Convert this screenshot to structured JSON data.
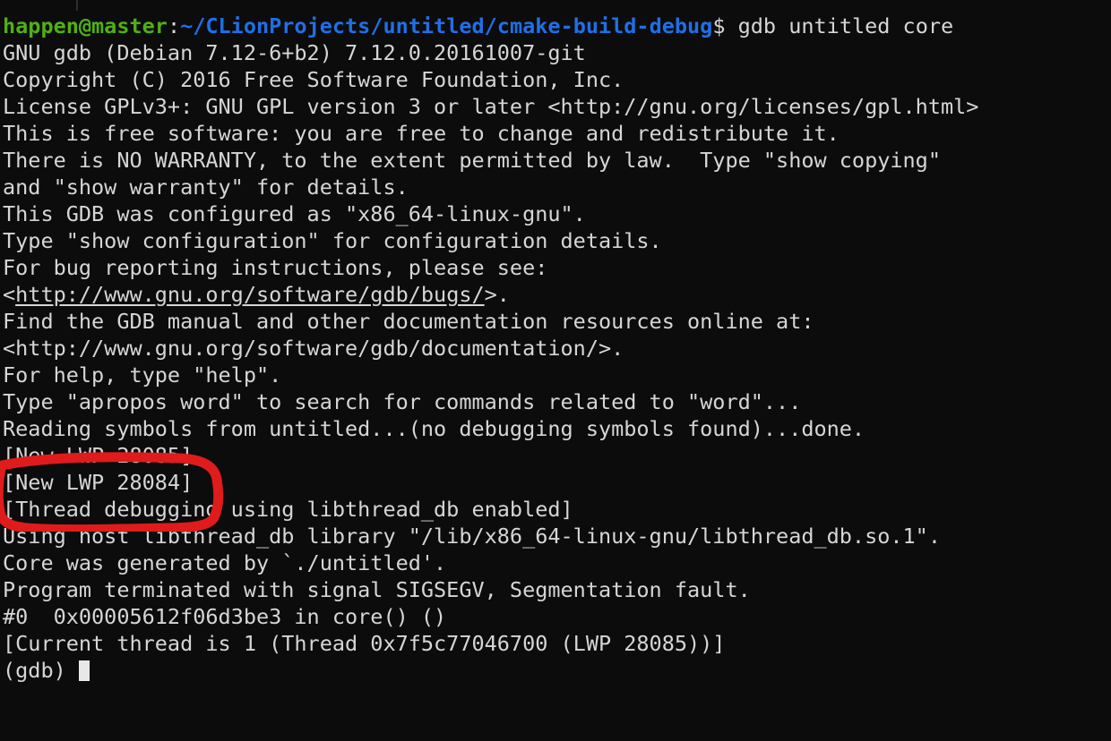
{
  "terminal": {
    "background_color": "#0c0c0c",
    "foreground_color": "#d6d6d6",
    "prompt": {
      "user_host": "happen@master",
      "separator": ":",
      "path": "~/CLionProjects/untitled/cmake-build-debug",
      "sigil": "$",
      "command": " gdb untitled core",
      "user_host_color": "#4fb014",
      "path_color": "#1f6fe8"
    },
    "lines": [
      "GNU gdb (Debian 7.12-6+b2) 7.12.0.20161007-git",
      "Copyright (C) 2016 Free Software Foundation, Inc.",
      "License GPLv3+: GNU GPL version 3 or later <http://gnu.org/licenses/gpl.html>",
      "This is free software: you are free to change and redistribute it.",
      "There is NO WARRANTY, to the extent permitted by law.  Type \"show copying\"",
      "and \"show warranty\" for details.",
      "This GDB was configured as \"x86_64-linux-gnu\".",
      "Type \"show configuration\" for configuration details.",
      "For bug reporting instructions, please see:"
    ],
    "bug_url_line": {
      "prefix": "<",
      "url": "http://www.gnu.org/software/gdb/bugs/",
      "suffix": ">."
    },
    "lines_after_bug_url": [
      "Find the GDB manual and other documentation resources online at:",
      "<http://www.gnu.org/software/gdb/documentation/>.",
      "For help, type \"help\".",
      "Type \"apropos word\" to search for commands related to \"word\"...",
      "Reading symbols from untitled...(no debugging symbols found)...done.",
      "[New LWP 28085]",
      "[New LWP 28084]",
      "[Thread debugging using libthread_db enabled]",
      "Using host libthread_db library \"/lib/x86_64-linux-gnu/libthread_db.so.1\".",
      "Core was generated by `./untitled'.",
      "Program terminated with signal SIGSEGV, Segmentation fault.",
      "#0  0x00005612f06d3be3 in core() ()",
      "[Current thread is 1 (Thread 0x7f5c77046700 (LWP 28085))]"
    ],
    "final_prompt": "(gdb) ",
    "cursor": {
      "name": "block-cursor",
      "color": "#e8e8e8"
    }
  },
  "annotation": {
    "type": "hand-drawn-rounded-rectangle",
    "color": "#e01b1b",
    "targets": [
      "[New LWP 28085]",
      "[New LWP 28084]"
    ]
  }
}
